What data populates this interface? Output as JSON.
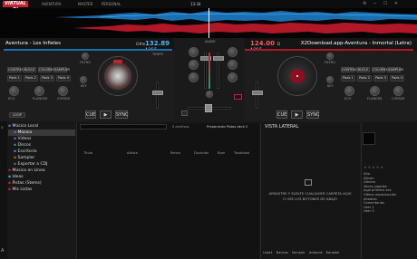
{
  "app": {
    "logo": "VIRTUAL DJ",
    "user": "AVENTURA",
    "mode": "MASTER",
    "view": "PERSONAL",
    "clock": "13:34",
    "accent": "#c0232e"
  },
  "deck_left": {
    "title": "Aventura - Los Infieles",
    "bpm": "132.89",
    "pitch": "+0.0%",
    "time": "4:16.5",
    "key": "G#m",
    "pads": [
      "Pads 1",
      "Pads 2",
      "Pads 3",
      "Pads 4"
    ],
    "controls": [
      "CONTROLES",
      "BUCLE",
      "COLORES",
      "SAMPLER"
    ],
    "loop_labels": [
      "LOOP",
      "1/2",
      "1",
      "2",
      "4",
      "8",
      "16",
      "32"
    ],
    "transport": [
      "CUE",
      "PLAY",
      "SYNC"
    ],
    "filter_label": "FILTRO",
    "key_label": "KEY",
    "fx_labels": [
      "ECO",
      "FLANGER",
      "CORTAR"
    ],
    "tempo_label": "TEMPO"
  },
  "deck_right": {
    "title": "X2Download.app-Aventura - Inmortal (Letra)",
    "bpm": "124.00",
    "pitch": "+0.0%",
    "time": "4:16.5",
    "key": "D",
    "pads": [
      "Pads 1",
      "Pads 2",
      "Pads 3",
      "Pads 4"
    ],
    "controls": [
      "CONTROLES",
      "BUCLE",
      "COLORES",
      "SAMPLER"
    ],
    "transport": [
      "CUE",
      "PLAY",
      "SYNC"
    ],
    "filter_label": "FILTRO",
    "key_label": "KEY",
    "fx_labels": [
      "ECO",
      "FLANGER",
      "CORTAR"
    ]
  },
  "mixer": {
    "title": "AUDIO",
    "labels": [
      "AGUDOS",
      "MEDIOS",
      "GRAVES",
      "FILTRO",
      "GANANCIA",
      "MICROFONO",
      "MASTER",
      "AURICULAR"
    ]
  },
  "browser": {
    "tree": [
      {
        "label": "Música Local",
        "icon": "folder-icon",
        "color": "#3b7fd0"
      },
      {
        "label": "Música",
        "icon": "music-icon",
        "color": "#3b7fd0",
        "selected": true
      },
      {
        "label": "Videos",
        "icon": "video-icon",
        "color": "#8a56c2"
      },
      {
        "label": "Discos",
        "icon": "disc-icon",
        "color": "#2b9b6a"
      },
      {
        "label": "Escritorio",
        "icon": "desktop-icon",
        "color": "#2f8fd8"
      },
      {
        "label": "Sampler",
        "icon": "sampler-icon",
        "color": "#c05a2a"
      },
      {
        "label": "Exportar a CDJ",
        "icon": "export-icon",
        "color": "#666"
      },
      {
        "label": "Música en Línea",
        "icon": "online-icon",
        "color": "#c0232e"
      },
      {
        "label": "Ideas",
        "icon": "ideas-icon",
        "color": "#3aa3d8"
      },
      {
        "label": "Pistas (Stems)",
        "icon": "stems-icon",
        "color": "#c0232e"
      },
      {
        "label": "Mis Listas",
        "icon": "list-icon",
        "color": "#c0232e"
      }
    ],
    "search_placeholder": "",
    "file_count": "0 archivos",
    "prepare_label": "Preparando Pistas deck 2",
    "columns": [
      "Título",
      "Artista",
      "Remix",
      "Duración",
      "Bpm",
      "Tonalidad"
    ],
    "side_title": "VISTA LATERAL",
    "side_msg1": "ARRASTRE Y SUELTE CUALQUIER CARPETA AQUÍ",
    "side_msg2": "O USE LOS BOTONES DE ABAJO",
    "side_tabs": [
      "Lista1",
      "Bancos",
      "Sampler",
      "Automix",
      "Karaoke"
    ]
  },
  "info": {
    "fields": [
      "Año",
      "Álbum",
      "Género",
      "Veces jugadas",
      "Jugó primera vez",
      "Última reproducción",
      "Añadido",
      "Comentarios",
      "User 1",
      "User 2"
    ]
  }
}
